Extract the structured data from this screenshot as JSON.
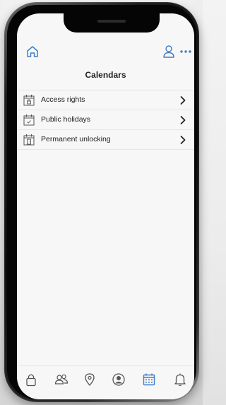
{
  "header": {
    "title": "Calendars"
  },
  "calendars": {
    "items": [
      {
        "label": "Access rights",
        "icon": "calendar-lock-icon"
      },
      {
        "label": "Public holidays",
        "icon": "calendar-check-icon"
      },
      {
        "label": "Permanent unlocking",
        "icon": "calendar-door-icon"
      }
    ]
  },
  "icons": {
    "home": "home-icon",
    "user": "user-icon",
    "more": "more-icon",
    "chevron": "chevron-right-icon"
  },
  "bottom_nav": {
    "items": [
      {
        "name": "lock-icon",
        "active": false
      },
      {
        "name": "users-icon",
        "active": false
      },
      {
        "name": "location-pin-icon",
        "active": false
      },
      {
        "name": "account-circle-icon",
        "active": false
      },
      {
        "name": "calendar-icon",
        "active": true
      },
      {
        "name": "bell-icon",
        "active": false
      }
    ]
  },
  "colors": {
    "accent": "#3f7fc4",
    "text": "#1f1f1f",
    "icon_gray": "#555555",
    "divider": "#e6e6e6"
  }
}
